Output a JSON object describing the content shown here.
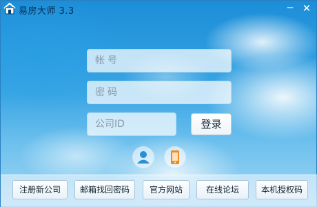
{
  "window": {
    "title": "易房大师 3.3"
  },
  "titlebar": {
    "minimize_label": "─",
    "close_label": "✕"
  },
  "login": {
    "account_placeholder": "帐号",
    "password_placeholder": "密码",
    "company_placeholder": "公司ID",
    "login_label": "登录"
  },
  "icons": {
    "app": "house-icon",
    "person": "person-icon",
    "mobile": "mobile-phone-icon"
  },
  "bottom": {
    "register_label": "注册新公司",
    "recover_label": "邮箱找回密码",
    "website_label": "官方网站",
    "forum_label": "在线论坛",
    "auth_label": "本机授权码"
  }
}
